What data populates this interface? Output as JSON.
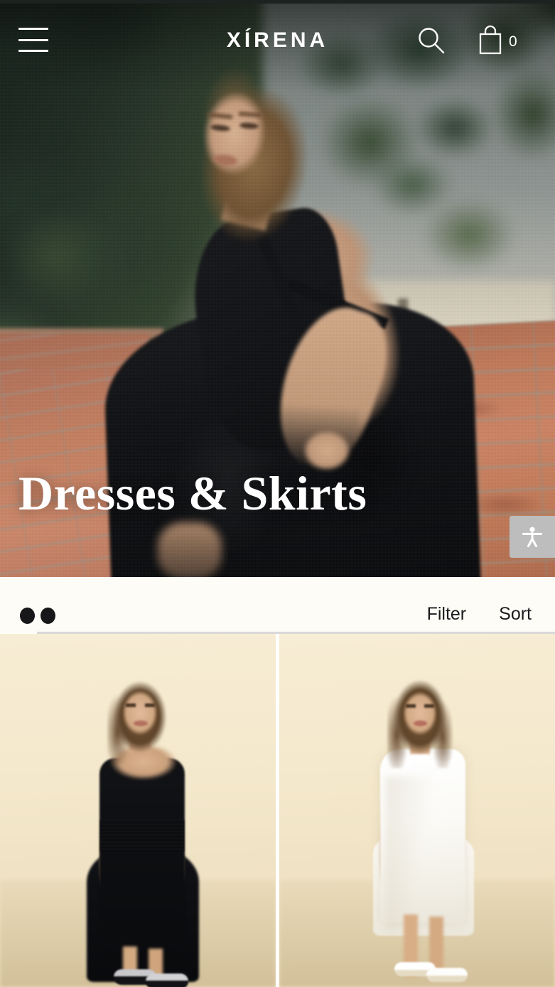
{
  "header": {
    "brand": "XÍRENA",
    "menu_icon": "hamburger-menu-icon",
    "search_icon": "search-icon",
    "bag_icon": "shopping-bag-icon",
    "bag_count": "0"
  },
  "hero": {
    "title": "Dresses & Skirts",
    "description": "Model in black backless halter dress standing on brick steps",
    "colors": {
      "sky": "#8d9491",
      "foliage": "#2a3a2c",
      "brick": "#c98566",
      "dress": "#0f1013"
    }
  },
  "accessibility": {
    "label": "Accessibility",
    "icon": "accessibility-person-icon",
    "background": "#bdbdbd"
  },
  "filter_bar": {
    "grid_toggle": {
      "icon": "two-column-grid-icon",
      "columns": "2"
    },
    "filter_label": "Filter",
    "sort_label": "Sort",
    "background": "#fdfcf6"
  },
  "products": [
    {
      "name": "black-sleeveless-dress",
      "description": "Model wearing black sleeveless halter midi dress with silver sandals",
      "dress_color": "#0f1013",
      "backdrop_color": "#f4e8cc"
    },
    {
      "name": "white-ruffle-dress",
      "description": "Model wearing white one-shoulder ruffle mini dress with white sandals",
      "dress_color": "#ffffff",
      "backdrop_color": "#f4e8cc"
    }
  ]
}
